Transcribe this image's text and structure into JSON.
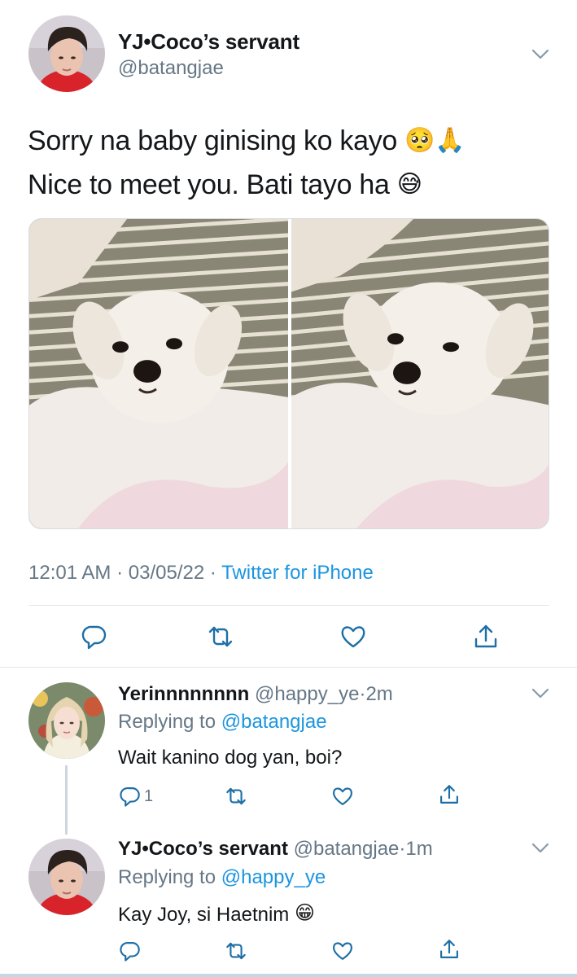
{
  "main_tweet": {
    "name": "YJ•Coco’s servant",
    "handle": "@batangjae",
    "text_line1": "Sorry na baby ginising ko kayo",
    "text_line1_emojis": "🥺🙏",
    "text_line2": "Nice to meet you. Bati tayo ha",
    "text_line2_emoji": "😅",
    "time": "12:01 AM",
    "date": "03/05/22",
    "source": "Twitter for iPhone",
    "separator": "·"
  },
  "replies": [
    {
      "name": "Yerinnnnnnnn",
      "handle": "@happy_ye",
      "age": "2m",
      "replying_prefix": "Replying to",
      "replying_to": "@batangjae",
      "text": "Wait kanino dog yan, boi?",
      "emoji": "",
      "reply_count": "1"
    },
    {
      "name": "YJ•Coco’s servant",
      "handle": "@batangjae",
      "age": "1m",
      "replying_prefix": "Replying to",
      "replying_to": "@happy_ye",
      "text": "Kay Joy, si Haetnim",
      "emoji": "😁",
      "reply_count": ""
    }
  ],
  "colors": {
    "text": "#14171a",
    "secondary": "#657786",
    "link": "#1b95e0",
    "divider": "#e1e8ed",
    "icon": "#1d6fa5"
  },
  "icons": {
    "reply": "speech-bubble-icon",
    "retweet": "retweet-arrows-icon",
    "like": "heart-icon",
    "share": "share-upload-icon",
    "menu": "chevron-down-icon"
  }
}
